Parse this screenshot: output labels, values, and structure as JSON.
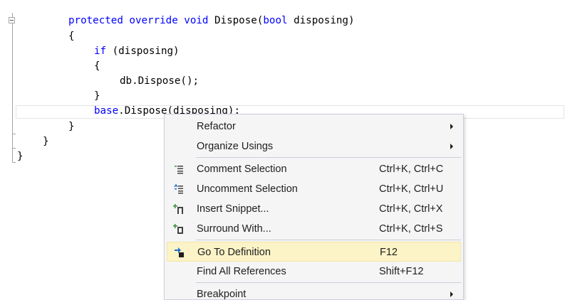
{
  "code": {
    "lines": [
      {
        "indent": 96,
        "parts": [
          {
            "t": "protected ",
            "k": true
          },
          {
            "t": "override ",
            "k": true
          },
          {
            "t": "void ",
            "k": true
          },
          {
            "t": "Dispose(",
            "k": false
          },
          {
            "t": "bool ",
            "k": true
          },
          {
            "t": "disposing)",
            "k": false
          }
        ]
      },
      {
        "indent": 96,
        "parts": [
          {
            "t": "{",
            "k": false
          }
        ]
      },
      {
        "indent": 132,
        "parts": [
          {
            "t": "if ",
            "k": true
          },
          {
            "t": "(disposing)",
            "k": false
          }
        ]
      },
      {
        "indent": 132,
        "parts": [
          {
            "t": "{",
            "k": false
          }
        ]
      },
      {
        "indent": 168,
        "parts": [
          {
            "t": "db.Dispose();",
            "k": false
          }
        ]
      },
      {
        "indent": 132,
        "parts": [
          {
            "t": "}",
            "k": false
          }
        ]
      },
      {
        "indent": 132,
        "parts": [
          {
            "t": "base",
            "k": true
          },
          {
            "t": ".Dispose(disposing);",
            "k": false
          }
        ]
      },
      {
        "indent": 96,
        "parts": [
          {
            "t": "}",
            "k": false
          }
        ]
      },
      {
        "indent": 60,
        "parts": [
          {
            "t": "}",
            "k": false
          }
        ]
      },
      {
        "indent": 24,
        "parts": [
          {
            "t": "}",
            "k": false
          }
        ]
      }
    ]
  },
  "context_menu": {
    "items": [
      {
        "id": "refactor",
        "label": "Refactor",
        "shortcut": "",
        "submenu": true,
        "icon": ""
      },
      {
        "id": "organize-usings",
        "label": "Organize Usings",
        "shortcut": "",
        "submenu": true,
        "icon": ""
      },
      {
        "separator": true
      },
      {
        "id": "comment-selection",
        "label": "Comment Selection",
        "shortcut": "Ctrl+K, Ctrl+C",
        "submenu": false,
        "icon": "comment-icon"
      },
      {
        "id": "uncomment-selection",
        "label": "Uncomment Selection",
        "shortcut": "Ctrl+K, Ctrl+U",
        "submenu": false,
        "icon": "uncomment-icon"
      },
      {
        "id": "insert-snippet",
        "label": "Insert Snippet...",
        "shortcut": "Ctrl+K, Ctrl+X",
        "submenu": false,
        "icon": "snippet-icon"
      },
      {
        "id": "surround-with",
        "label": "Surround With...",
        "shortcut": "Ctrl+K, Ctrl+S",
        "submenu": false,
        "icon": "surround-icon"
      },
      {
        "separator": true
      },
      {
        "id": "go-to-definition",
        "label": "Go To Definition",
        "shortcut": "F12",
        "submenu": false,
        "icon": "go-to-definition-icon",
        "highlighted": true
      },
      {
        "id": "find-all-references",
        "label": "Find All References",
        "shortcut": "Shift+F12",
        "submenu": false,
        "icon": ""
      },
      {
        "separator": true
      },
      {
        "id": "breakpoint",
        "label": "Breakpoint",
        "shortcut": "",
        "submenu": true,
        "icon": ""
      }
    ]
  },
  "colors": {
    "keyword": "#0000ff",
    "text": "#000000",
    "menu_bg": "#f5f5f5",
    "menu_highlight": "#fcf3c6",
    "icon_green": "#388a34",
    "icon_blue": "#1e6fc8"
  }
}
